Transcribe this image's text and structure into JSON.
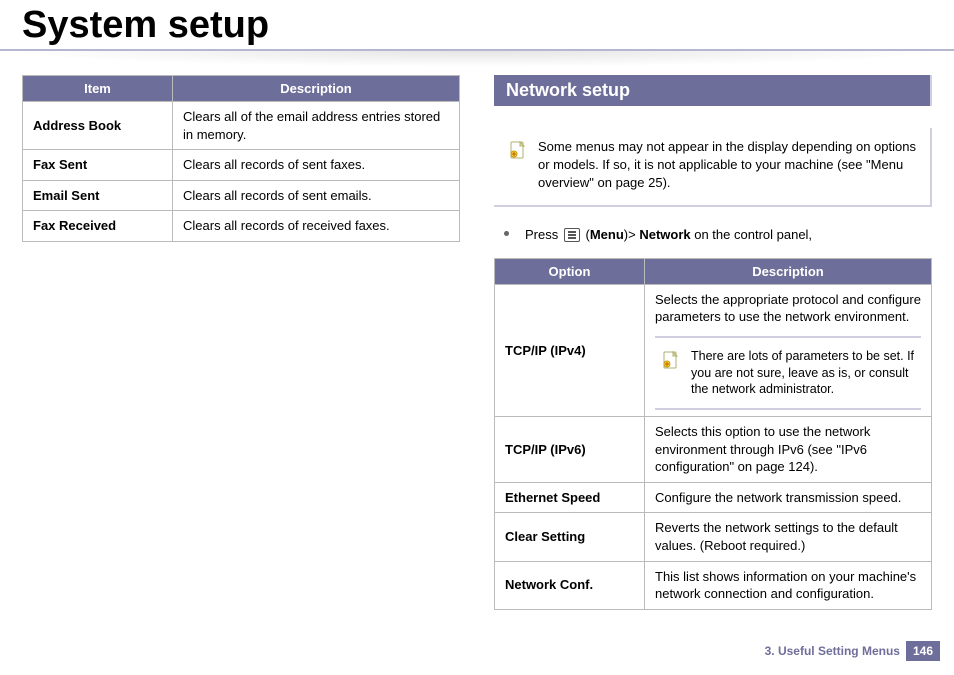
{
  "title": "System setup",
  "left_table": {
    "headers": [
      "Item",
      "Description"
    ],
    "rows": [
      {
        "item": "Address Book",
        "desc": "Clears all of the email address entries stored in memory."
      },
      {
        "item": "Fax Sent",
        "desc": "Clears all records of sent faxes."
      },
      {
        "item": "Email Sent",
        "desc": "Clears all records of sent emails."
      },
      {
        "item": "Fax Received",
        "desc": "Clears all records of received faxes."
      }
    ]
  },
  "section_heading": "Network setup",
  "top_note": "Some menus may not appear in the display depending on options or models. If so, it is not applicable to your machine (see \"Menu overview\" on page 25).",
  "bullet": {
    "press": "Press",
    "menu_open": "(",
    "menu": "Menu",
    "menu_close": ")>",
    "network": "Network",
    "tail": " on the control panel,"
  },
  "right_table": {
    "headers": [
      "Option",
      "Description"
    ],
    "rows": [
      {
        "item": "TCP/IP (IPv4)",
        "desc": "Selects the appropriate protocol and configure parameters to use the network environment.",
        "note": "There are lots of parameters to be set. If you are not sure, leave as is, or consult the network administrator."
      },
      {
        "item": "TCP/IP (IPv6)",
        "desc": "Selects this option to use the network environment through IPv6 (see \"IPv6 configuration\" on page 124)."
      },
      {
        "item": "Ethernet Speed",
        "desc": "Configure the network transmission speed."
      },
      {
        "item": "Clear Setting",
        "desc": "Reverts the network settings to the default values. (Reboot required.)"
      },
      {
        "item": "Network Conf.",
        "desc": "This list shows information on your machine's network connection and configuration."
      }
    ]
  },
  "footer": {
    "chapter": "3.  Useful Setting Menus",
    "page": "146"
  }
}
